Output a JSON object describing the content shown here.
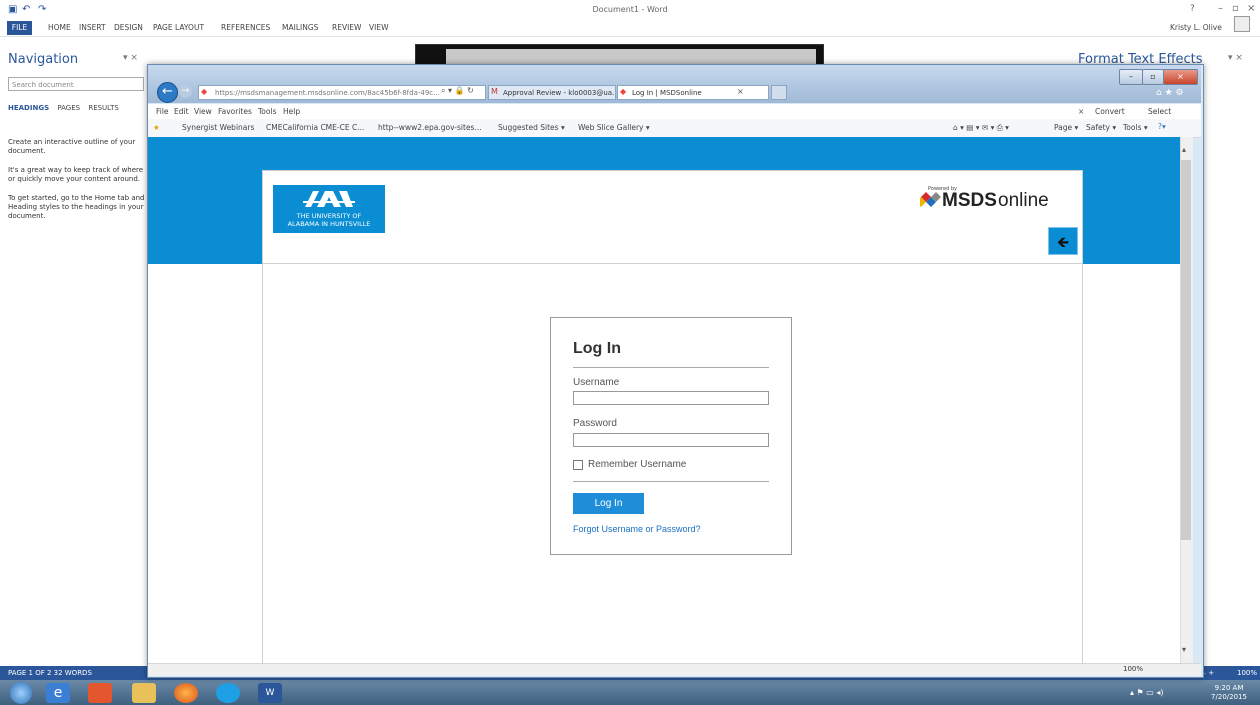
{
  "word": {
    "title": "Document1 - Word",
    "tabs": [
      "FILE",
      "HOME",
      "INSERT",
      "DESIGN",
      "PAGE LAYOUT",
      "REFERENCES",
      "MAILINGS",
      "REVIEW",
      "VIEW"
    ],
    "user": "Kristy L. Olive",
    "nav_title": "Navigation",
    "nav_search_placeholder": "Search document",
    "nav_tabs": [
      "HEADINGS",
      "PAGES",
      "RESULTS"
    ],
    "nav_text": [
      "Create an interactive outline of your document.",
      "It's a great way to keep track of where or quickly move your content around.",
      "To get started, go to the Home tab and Heading styles to the headings in your document."
    ],
    "right_pane_title": "Format Text Effects",
    "status": "PAGE 1 OF 2   32 WORDS",
    "zoom": "100%"
  },
  "ie": {
    "address": "https://msdsmanagement.msdsonline.com/8ac45b6f-8fda-49c...",
    "tabs": [
      "Approval Review - klo0003@ua...",
      "Log In | MSDSonline"
    ],
    "menu": [
      "File",
      "Edit",
      "View",
      "Favorites",
      "Tools",
      "Help"
    ],
    "convert": "Convert",
    "select": "Select",
    "favorites": [
      "Synergist Webinars",
      "CMECalifornia CME-CE C...",
      "http--www2.epa.gov-sites...",
      "Suggested Sites ▾",
      "Web Slice Gallery ▾"
    ],
    "cmdbar": [
      "Page ▾",
      "Safety ▾",
      "Tools ▾"
    ],
    "zoom": "100%"
  },
  "page": {
    "uah_line1": "THE UNIVERSITY OF",
    "uah_line2": "ALABAMA IN HUNTSVILLE",
    "powered_by": "Powered by",
    "brand_msds": "MSDS",
    "brand_online": "online",
    "login": {
      "title": "Log In",
      "username_label": "Username",
      "password_label": "Password",
      "remember_label": "Remember Username",
      "button": "Log In",
      "forgot": "Forgot Username or Password?"
    }
  },
  "taskbar": {
    "time": "9:20 AM",
    "date": "7/20/2015"
  },
  "colors": {
    "accent": "#0a8dd3",
    "word_blue": "#2b579a",
    "button": "#1f8ed8"
  }
}
